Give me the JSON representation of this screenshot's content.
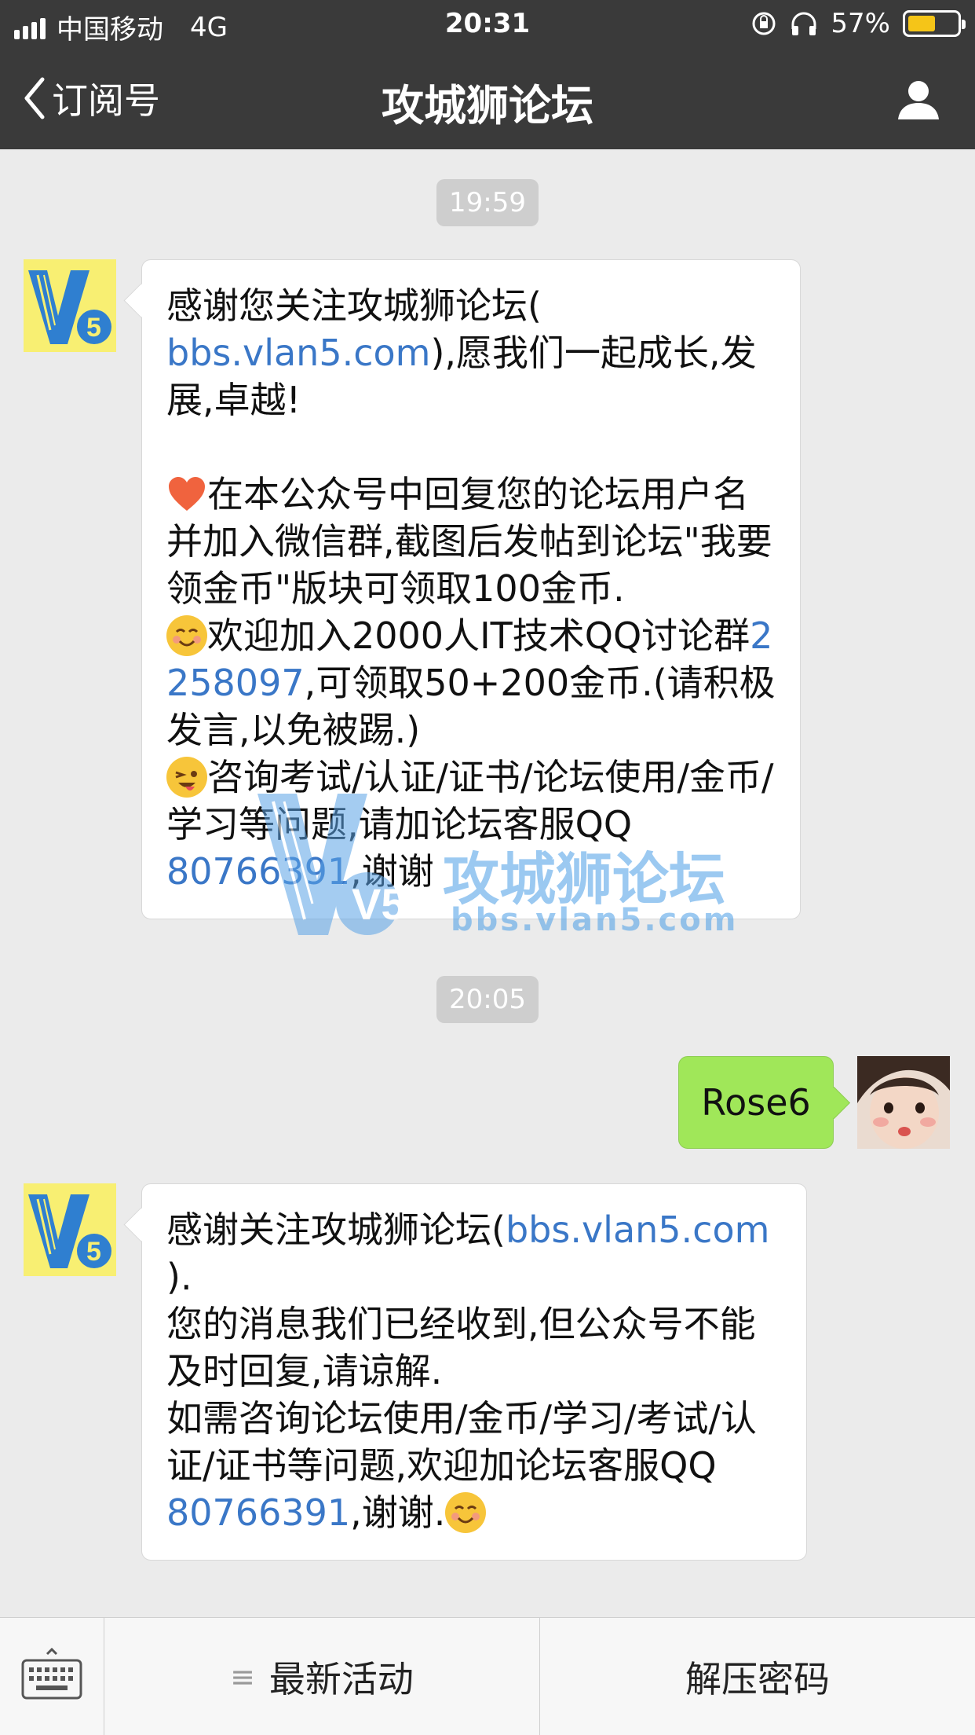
{
  "status_bar": {
    "carrier": "中国移动",
    "network": "4G",
    "time": "20:31",
    "battery_percent": "57%",
    "battery_level": 0.57
  },
  "nav": {
    "back_label": "订阅号",
    "title": "攻城狮论坛"
  },
  "messages": [
    {
      "timestamp": "19:59",
      "side": "left",
      "parts": [
        "感谢您关注攻城狮论坛(",
        "bbs.vlan5.com",
        "),愿我们一起成长,发展,卓越!",
        "在本公众号中回复您的论坛用户名并加入微信群,截图后发帖到论坛\"我要领金币\"版块可领取100金币.",
        "欢迎加入2000人IT技术QQ讨论群",
        "2258097",
        ",可领取50+200金币.(请积极发言,以免被踢.)",
        "咨询考试/认证/证书/论坛使用/金币/学习等问题,请加论坛客服QQ",
        "80766391",
        ",谢谢"
      ]
    },
    {
      "timestamp": "20:05",
      "side": "right",
      "text": "Rose6"
    },
    {
      "side": "left",
      "parts": [
        "感谢关注攻城狮论坛(",
        "bbs.vlan5.com",
        ").",
        "您的消息我们已经收到,但公众号不能及时回复,请谅解.",
        "如需咨询论坛使用/金币/学习/考试/认证/证书等问题,欢迎加论坛客服QQ",
        "80766391",
        ",谢谢."
      ]
    }
  ],
  "watermark": {
    "logo": "V5",
    "name": "攻城狮论坛",
    "url": "bbs.vlan5.com"
  },
  "bottom_menu": {
    "items": [
      "最新活动",
      "解压密码"
    ]
  },
  "icons": [
    "signal-icon",
    "back-chevron-icon",
    "profile-icon",
    "heart-emoji-icon",
    "smile-emoji-icon",
    "wink-emoji-icon",
    "keyboard-icon",
    "menu-lines-icon"
  ],
  "colors": {
    "nav_bg": "#3a3a3a",
    "chat_bg": "#ebebeb",
    "link": "#3a77c7",
    "sent_bubble": "#a0e759",
    "battery_fill": "#f5c518"
  }
}
